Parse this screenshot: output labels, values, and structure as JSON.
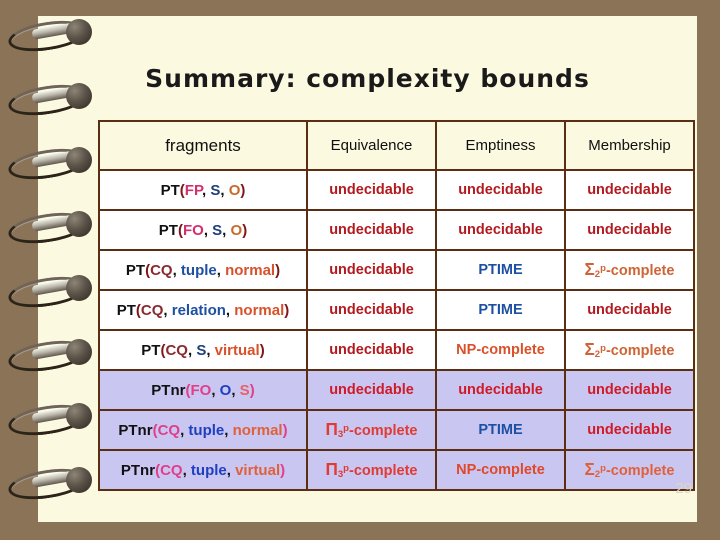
{
  "slide": {
    "title": "Summary: complexity bounds",
    "page_number": "29",
    "background_color": "#8b7357",
    "page_color": "#fbfae1",
    "shaded_row_color": "#c9c6f2"
  },
  "table": {
    "headers": {
      "fragments": "fragments",
      "equivalence": "Equivalence",
      "emptiness": "Emptiness",
      "membership": "Membership"
    },
    "rows": [
      {
        "shaded": false,
        "fragment": {
          "prefix": "PT",
          "open": "(",
          "a": "FP",
          "a_color": "#d32f6e",
          "b": "S",
          "b_color": "#1f3f7a",
          "c": "O",
          "c_color": "#c96a2b",
          "close": ")"
        },
        "equivalence": "undecidable",
        "emptiness": "undecidable",
        "membership": "undecidable"
      },
      {
        "shaded": false,
        "fragment": {
          "prefix": "PT",
          "open": "(",
          "a": "FO",
          "a_color": "#d32f6e",
          "b": "S",
          "b_color": "#1f3f7a",
          "c": "O",
          "c_color": "#c96a2b",
          "close": ")"
        },
        "equivalence": "undecidable",
        "emptiness": "undecidable",
        "membership": "undecidable"
      },
      {
        "shaded": false,
        "fragment": {
          "prefix": "PT",
          "open": "(",
          "a": "CQ",
          "a_color": "#8a2b2f",
          "b": "tuple",
          "b_color": "#1d4fa3",
          "c": "normal",
          "c_color": "#d9512a",
          "close": ")"
        },
        "equivalence": "undecidable",
        "emptiness": "PTIME",
        "membership": "Σ2p-complete"
      },
      {
        "shaded": false,
        "fragment": {
          "prefix": "PT",
          "open": "(",
          "a": "CQ",
          "a_color": "#8a2b2f",
          "b": "relation",
          "b_color": "#1d4fa3",
          "c": "normal",
          "c_color": "#d9512a",
          "close": ")"
        },
        "equivalence": "undecidable",
        "emptiness": "PTIME",
        "membership": "undecidable"
      },
      {
        "shaded": false,
        "fragment": {
          "prefix": "PT",
          "open": "(",
          "a": "CQ",
          "a_color": "#8a2b2f",
          "b": "S",
          "b_color": "#1f3f7a",
          "c": "virtual",
          "c_color": "#d9512a",
          "close": ")"
        },
        "equivalence": "undecidable",
        "emptiness": "NP-complete",
        "membership": "Σ2p-complete"
      },
      {
        "shaded": true,
        "fragment": {
          "prefix": "PTnr",
          "open": "(",
          "a": "FO",
          "a_color": "#e0408a",
          "b": "O",
          "b_color": "#1f3fc0",
          "c": "S",
          "c_color": "#e8606a",
          "close": ")"
        },
        "equivalence": "undecidable",
        "emptiness": "undecidable",
        "membership": "undecidable"
      },
      {
        "shaded": true,
        "fragment": {
          "prefix": "PTnr",
          "open": "(",
          "a": "CQ",
          "a_color": "#e0408a",
          "b": "tuple",
          "b_color": "#1f3fc0",
          "c": "normal",
          "c_color": "#e0603a",
          "close": ")"
        },
        "equivalence": "Π3p-complete",
        "emptiness": "PTIME",
        "membership": "undecidable"
      },
      {
        "shaded": true,
        "fragment": {
          "prefix": "PTnr",
          "open": "(",
          "a": "CQ",
          "a_color": "#e0408a",
          "b": "tuple",
          "b_color": "#1f3fc0",
          "c": "virtual",
          "c_color": "#e0603a",
          "close": ")"
        },
        "equivalence": "Π3p-complete",
        "emptiness": "NP-complete",
        "membership": "Σ2p-complete"
      }
    ],
    "symbols": {
      "sigma": "Σ",
      "pi": "Π",
      "sigma_sub": "2",
      "pi_sub": "3",
      "poly_sup": "p",
      "complete_suffix": "-complete",
      "undecidable": "undecidable",
      "ptime": "PTIME",
      "np_complete": "NP-complete"
    }
  }
}
